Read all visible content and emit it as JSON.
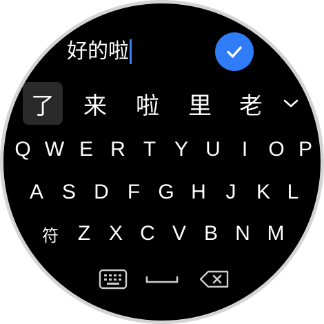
{
  "input": {
    "text": "好的啦"
  },
  "candidates": [
    "了",
    "来",
    "啦",
    "里",
    "老"
  ],
  "keyboard": {
    "row1": [
      "Q",
      "W",
      "E",
      "R",
      "T",
      "Y",
      "U",
      "I",
      "O",
      "P"
    ],
    "row2": [
      "A",
      "S",
      "D",
      "F",
      "G",
      "H",
      "J",
      "K",
      "L"
    ],
    "row3": [
      "Z",
      "X",
      "C",
      "V",
      "B",
      "N",
      "M"
    ],
    "symbol_key": "符"
  },
  "colors": {
    "accent": "#2f7cf6",
    "caret": "#3b82f6",
    "background": "#000000",
    "selected_candidate": "#2a2a2a"
  },
  "icons": {
    "confirm": "check-icon",
    "expand": "chevron-down-icon",
    "keyboard_switch": "keyboard-icon",
    "space": "space-bar-icon",
    "delete": "backspace-icon"
  }
}
